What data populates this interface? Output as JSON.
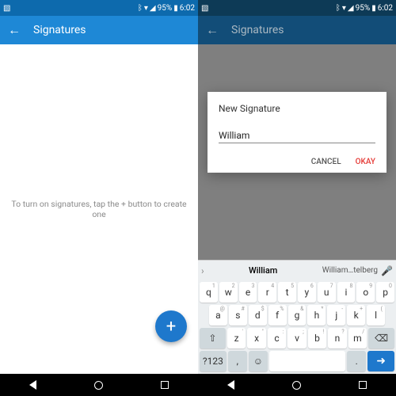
{
  "status": {
    "battery": "95%",
    "time": "6:02"
  },
  "appbar": {
    "title": "Signatures"
  },
  "hint_text": "To turn on signatures, tap the + button to create one",
  "fab_label": "+",
  "dialog": {
    "title": "New Signature",
    "input_value": "William",
    "cancel": "CANCEL",
    "ok": "OKAY"
  },
  "suggestions": {
    "center": "William",
    "right": "William…telberg"
  },
  "keyboard": {
    "row1": [
      "q",
      "w",
      "e",
      "r",
      "t",
      "y",
      "u",
      "i",
      "o",
      "p"
    ],
    "row1_super": [
      "1",
      "2",
      "3",
      "4",
      "5",
      "6",
      "7",
      "8",
      "9",
      "0"
    ],
    "row2": [
      "a",
      "s",
      "d",
      "f",
      "g",
      "h",
      "j",
      "k",
      "l"
    ],
    "row2_super": [
      "@",
      "#",
      "$",
      "%",
      "&",
      "*",
      "-",
      "+",
      "("
    ],
    "row3": [
      "z",
      "x",
      "c",
      "v",
      "b",
      "n",
      "m"
    ],
    "row3_super": [
      "'",
      "\"",
      ":",
      ";",
      "!",
      "?",
      "/"
    ],
    "sym_key": "?123",
    "comma": ",",
    "period": "."
  }
}
